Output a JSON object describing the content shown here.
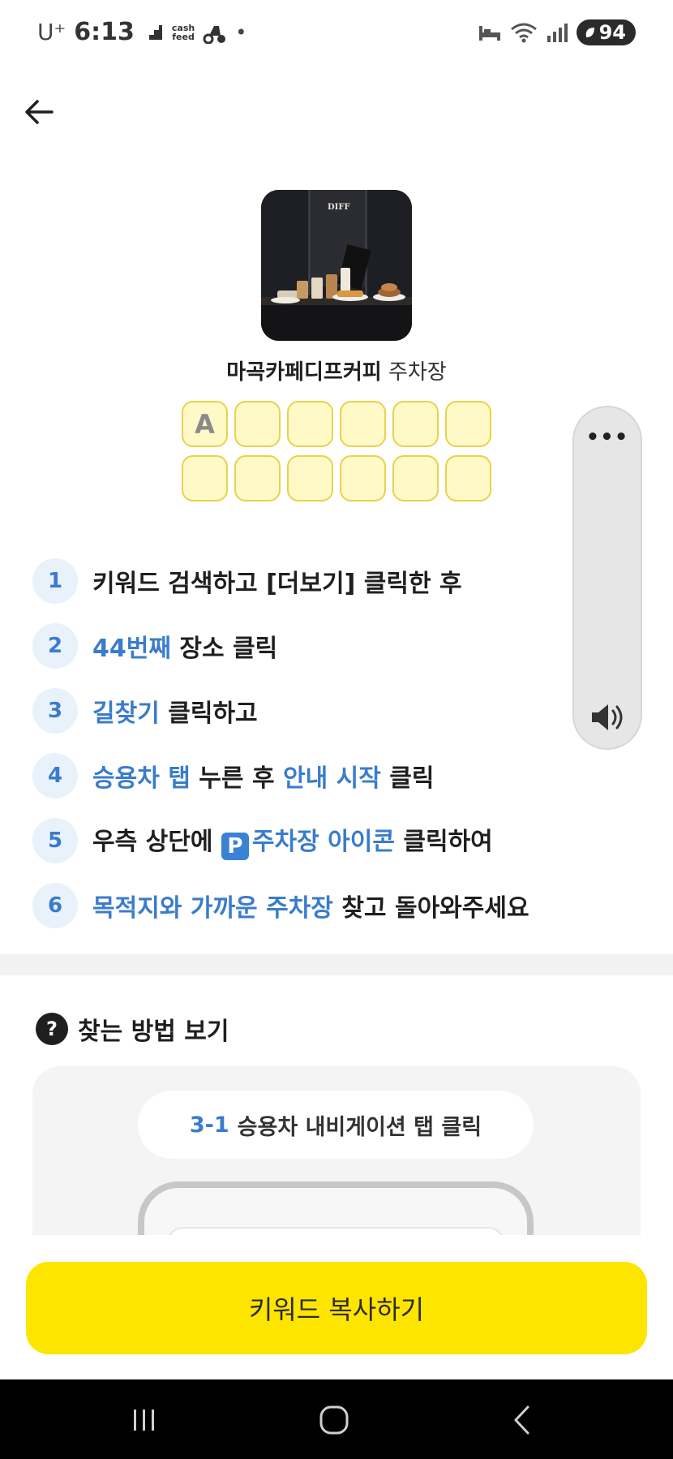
{
  "status_bar": {
    "carrier": "U⁺",
    "time": "6:13",
    "cash_line1": "cash",
    "cash_line2": "feed",
    "dot": "•",
    "battery": "94"
  },
  "place": {
    "name_bold": "마곡카페디프커피",
    "name_suffix": "주차장",
    "thumb_sign": "DIFF"
  },
  "keyword_boxes": [
    "A",
    "",
    "",
    "",
    "",
    "",
    "",
    "",
    "",
    "",
    "",
    ""
  ],
  "widget": {
    "more_label": "•••",
    "speaker_icon": "speaker-icon"
  },
  "steps": [
    {
      "num": "1",
      "parts": [
        {
          "text": "키워드 검색하고 [더보기] 클릭한 후",
          "hl": false
        }
      ]
    },
    {
      "num": "2",
      "parts": [
        {
          "text": "44번째",
          "hl": true
        },
        {
          "text": " 장소 클릭",
          "hl": false
        }
      ]
    },
    {
      "num": "3",
      "parts": [
        {
          "text": "길찾기",
          "hl": true
        },
        {
          "text": " 클릭하고",
          "hl": false
        }
      ]
    },
    {
      "num": "4",
      "parts": [
        {
          "text": "승용차 탭",
          "hl": true
        },
        {
          "text": " 누른 후 ",
          "hl": false
        },
        {
          "text": "안내 시작",
          "hl": true
        },
        {
          "text": " 클릭",
          "hl": false
        }
      ]
    },
    {
      "num": "5",
      "parts": [
        {
          "text": "우측 상단에 ",
          "hl": false
        },
        {
          "text": "P",
          "icon": true
        },
        {
          "text": "주차장 아이콘",
          "hl": true
        },
        {
          "text": " 클릭하여",
          "hl": false
        }
      ]
    },
    {
      "num": "6",
      "parts": [
        {
          "text": "목적지와 가까운 주차장",
          "hl": true
        },
        {
          "text": " 찾고 돌아와주세요",
          "hl": false
        }
      ]
    }
  ],
  "howto": {
    "title": "찾는 방법 보기",
    "q_mark": "?",
    "pill_step": "3-1",
    "pill_text": "승용차 내비게이션 탭 클릭"
  },
  "cta": {
    "label": "키워드 복사하기"
  },
  "colors": {
    "accent_blue": "#3a7ccc",
    "cta_yellow": "#fee500",
    "box_fill": "#fff8c7",
    "box_border": "#e8d34a"
  }
}
